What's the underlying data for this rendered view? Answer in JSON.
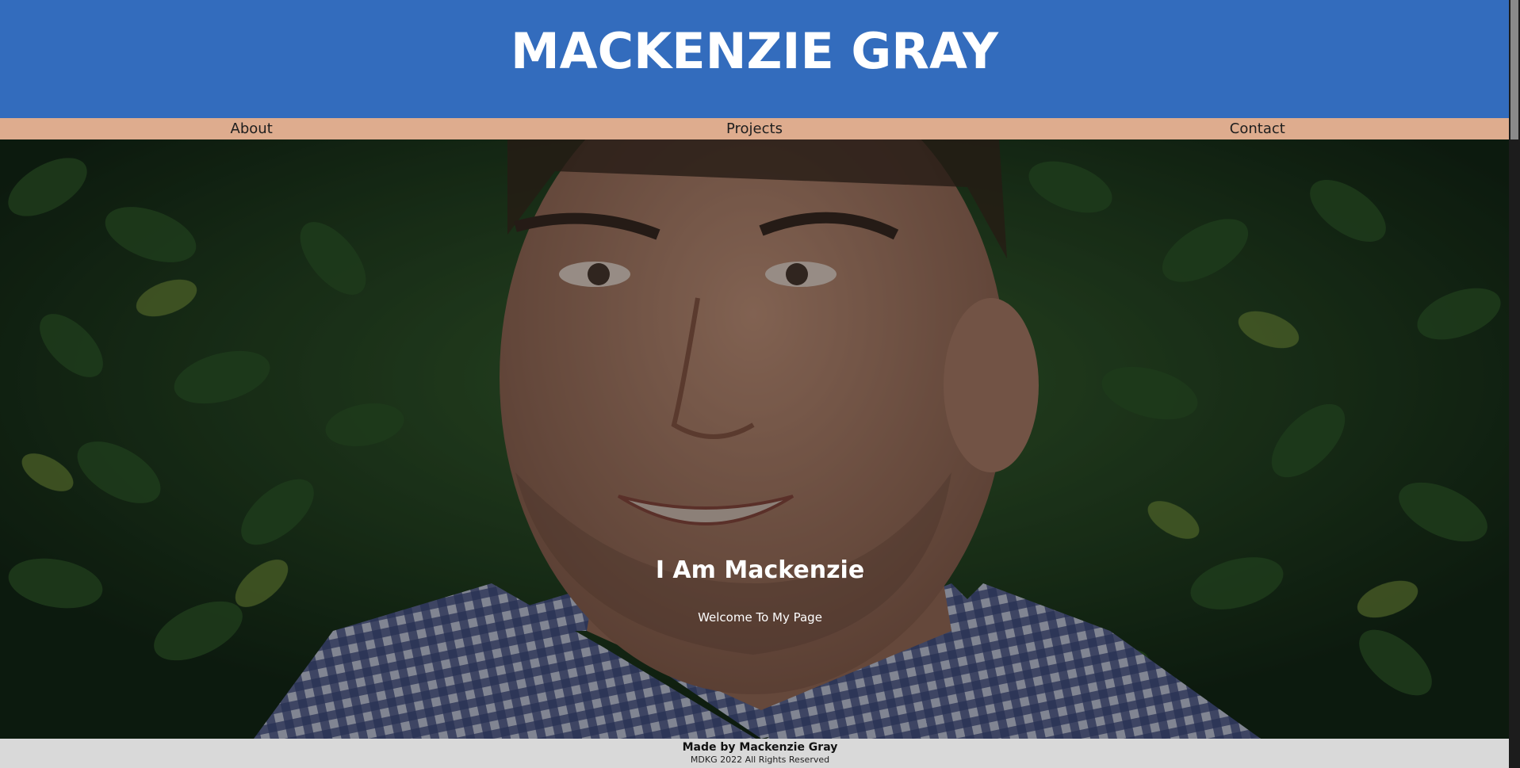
{
  "colors": {
    "header_bg": "#336cbd",
    "nav_bg": "#deac8e",
    "footer_bg": "#d9d9d9",
    "leaf_dark": "#1f3b22",
    "leaf_light": "#5e8a3c",
    "shirt": "#5a6a98",
    "skin": "#b98a72"
  },
  "header": {
    "title": "MACKENZIE GRAY"
  },
  "nav": {
    "items": [
      {
        "label": "About"
      },
      {
        "label": "Projects"
      },
      {
        "label": "Contact"
      }
    ]
  },
  "hero": {
    "image": "portrait-photo",
    "title": "I Am Mackenzie",
    "subtitle": "Welcome To My Page"
  },
  "footer": {
    "made_by": "Made by Mackenzie Gray",
    "rights": "MDKG 2022 All Rights Reserved"
  }
}
